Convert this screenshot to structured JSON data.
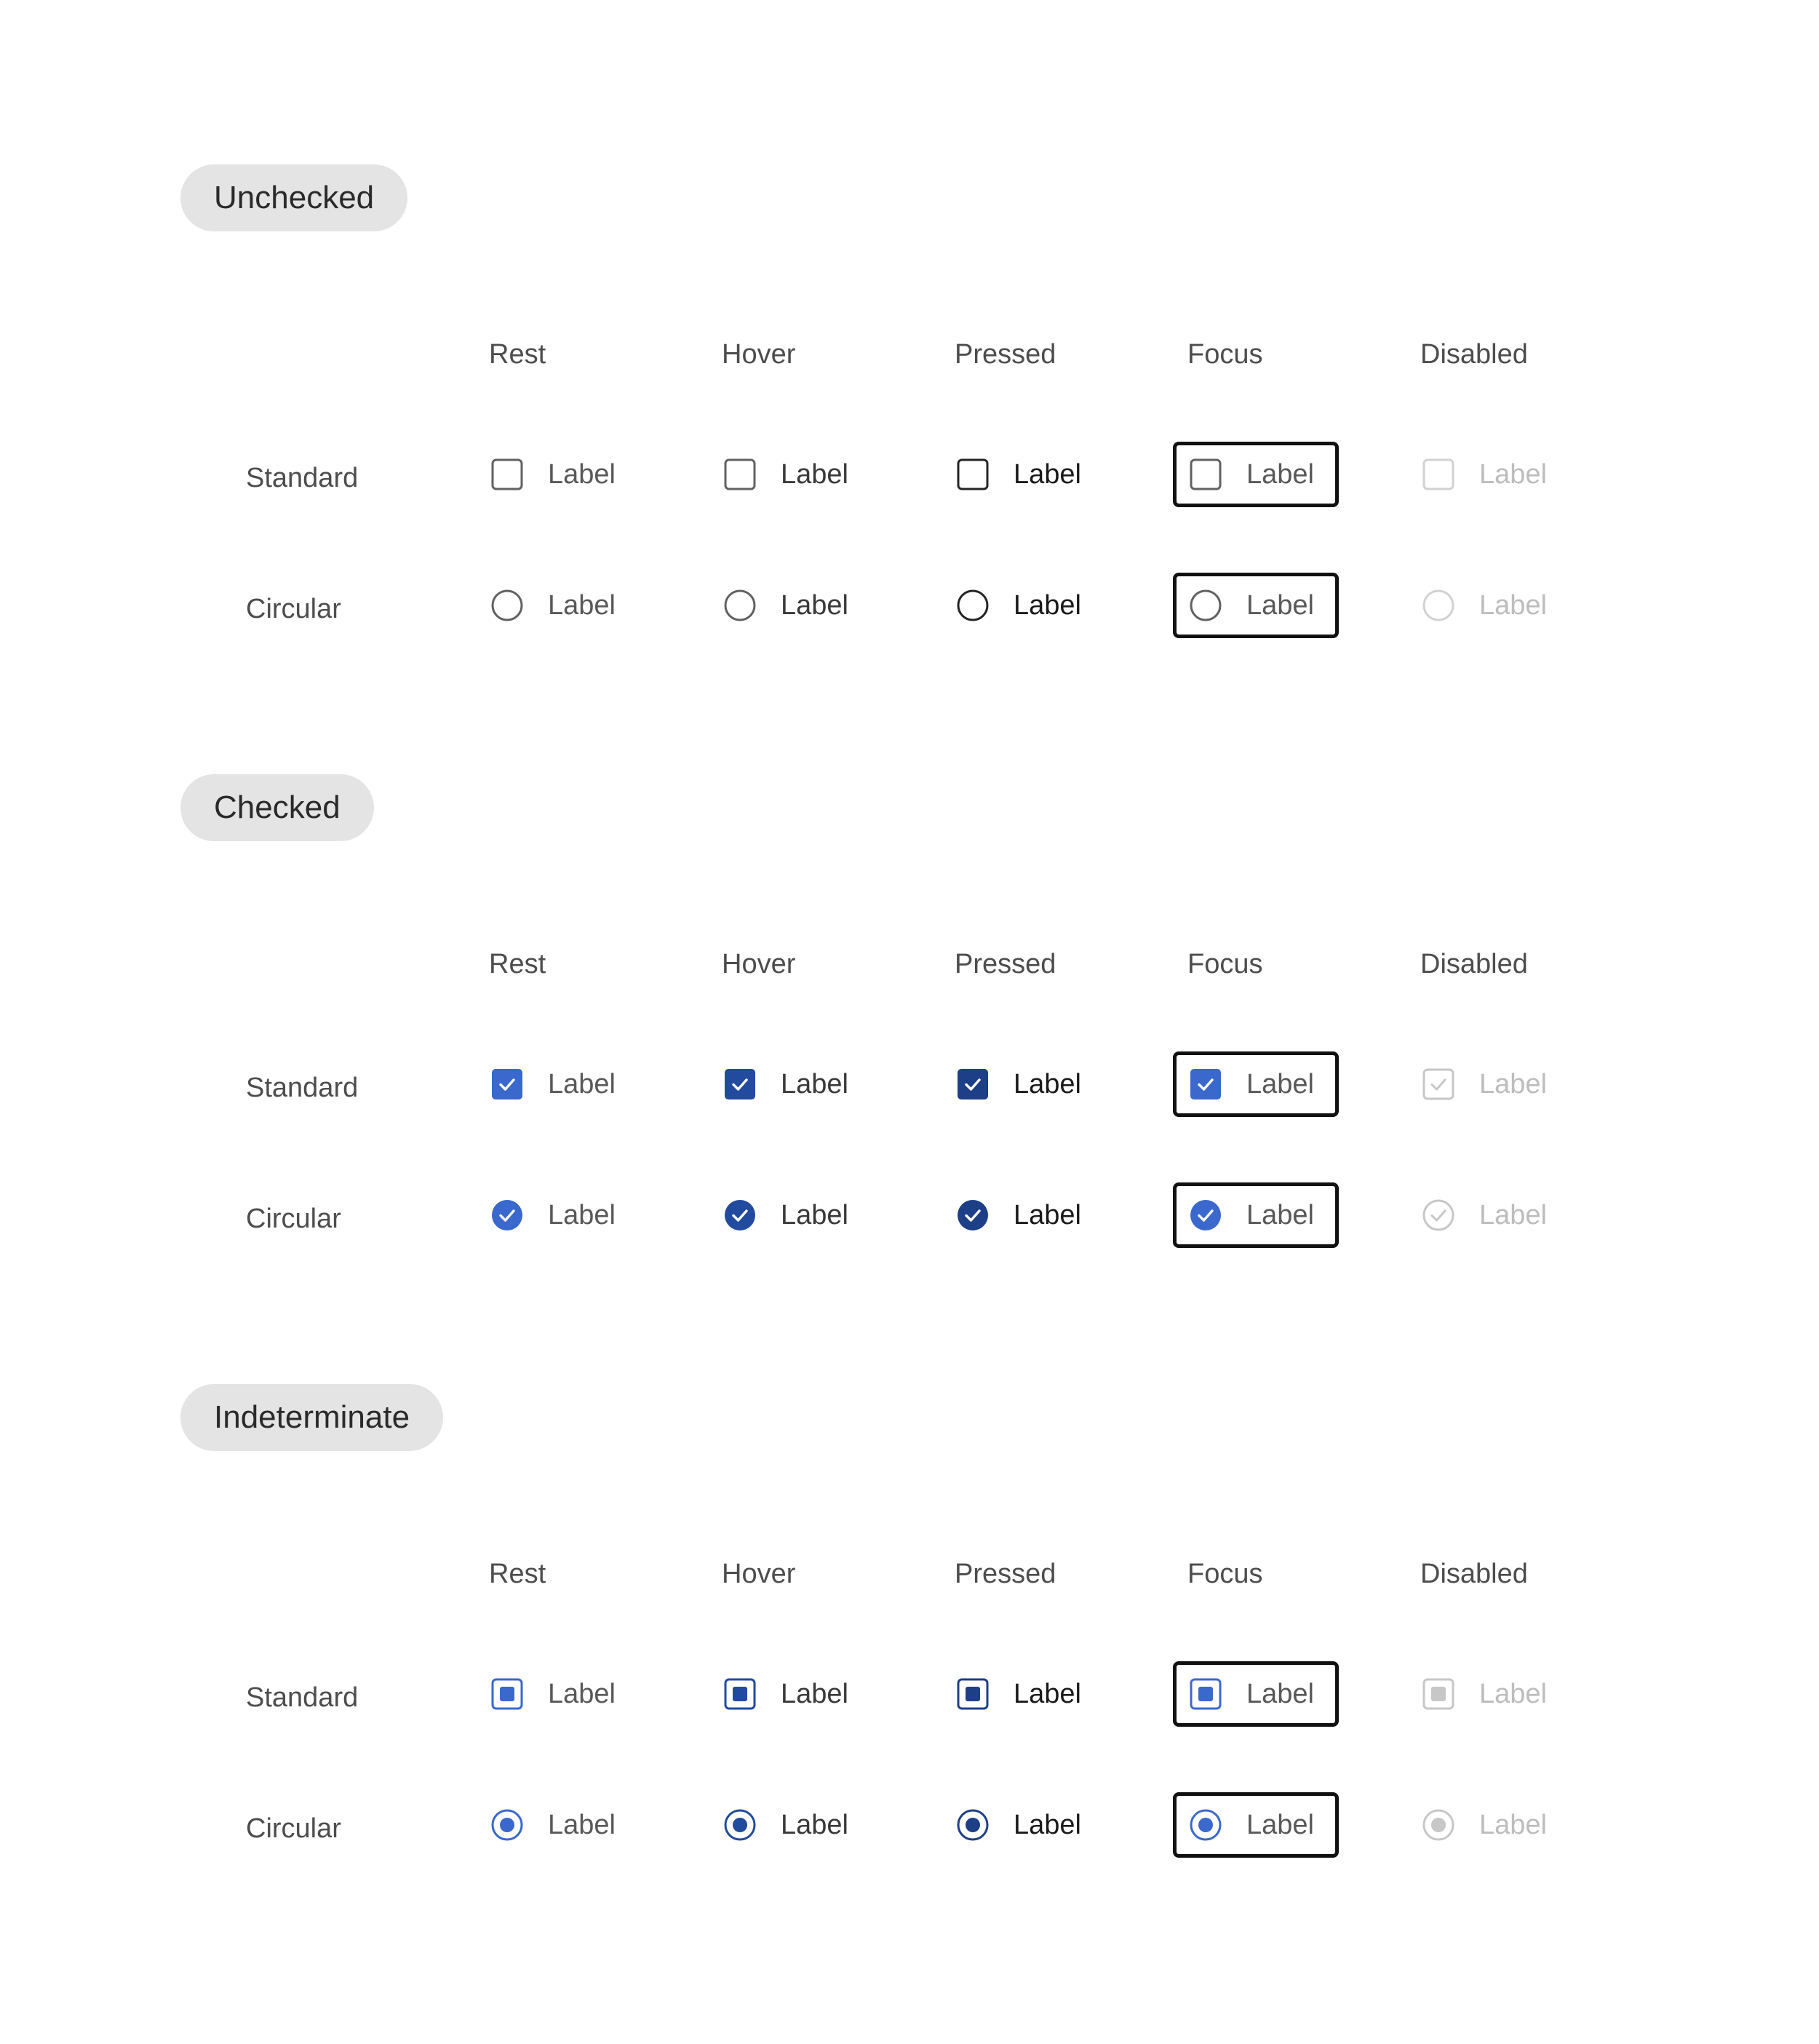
{
  "colors": {
    "rest_fill": "#3a68cc",
    "hover_fill": "#224a9e",
    "pressed_fill": "#1d3f88",
    "rest_border": "#616161",
    "pressed_border": "#242424",
    "disabled": "#c7c7c7",
    "focus_ring": "#111111"
  },
  "columns": [
    "Rest",
    "Hover",
    "Pressed",
    "Focus",
    "Disabled"
  ],
  "states": [
    "rest",
    "hover",
    "pressed",
    "focus",
    "disabled"
  ],
  "rows": [
    "Standard",
    "Circular"
  ],
  "control_label": "Label",
  "sections": [
    {
      "title": "Unchecked",
      "variant": "unchecked"
    },
    {
      "title": "Checked",
      "variant": "checked"
    },
    {
      "title": "Indeterminate",
      "variant": "indeterminate"
    }
  ]
}
